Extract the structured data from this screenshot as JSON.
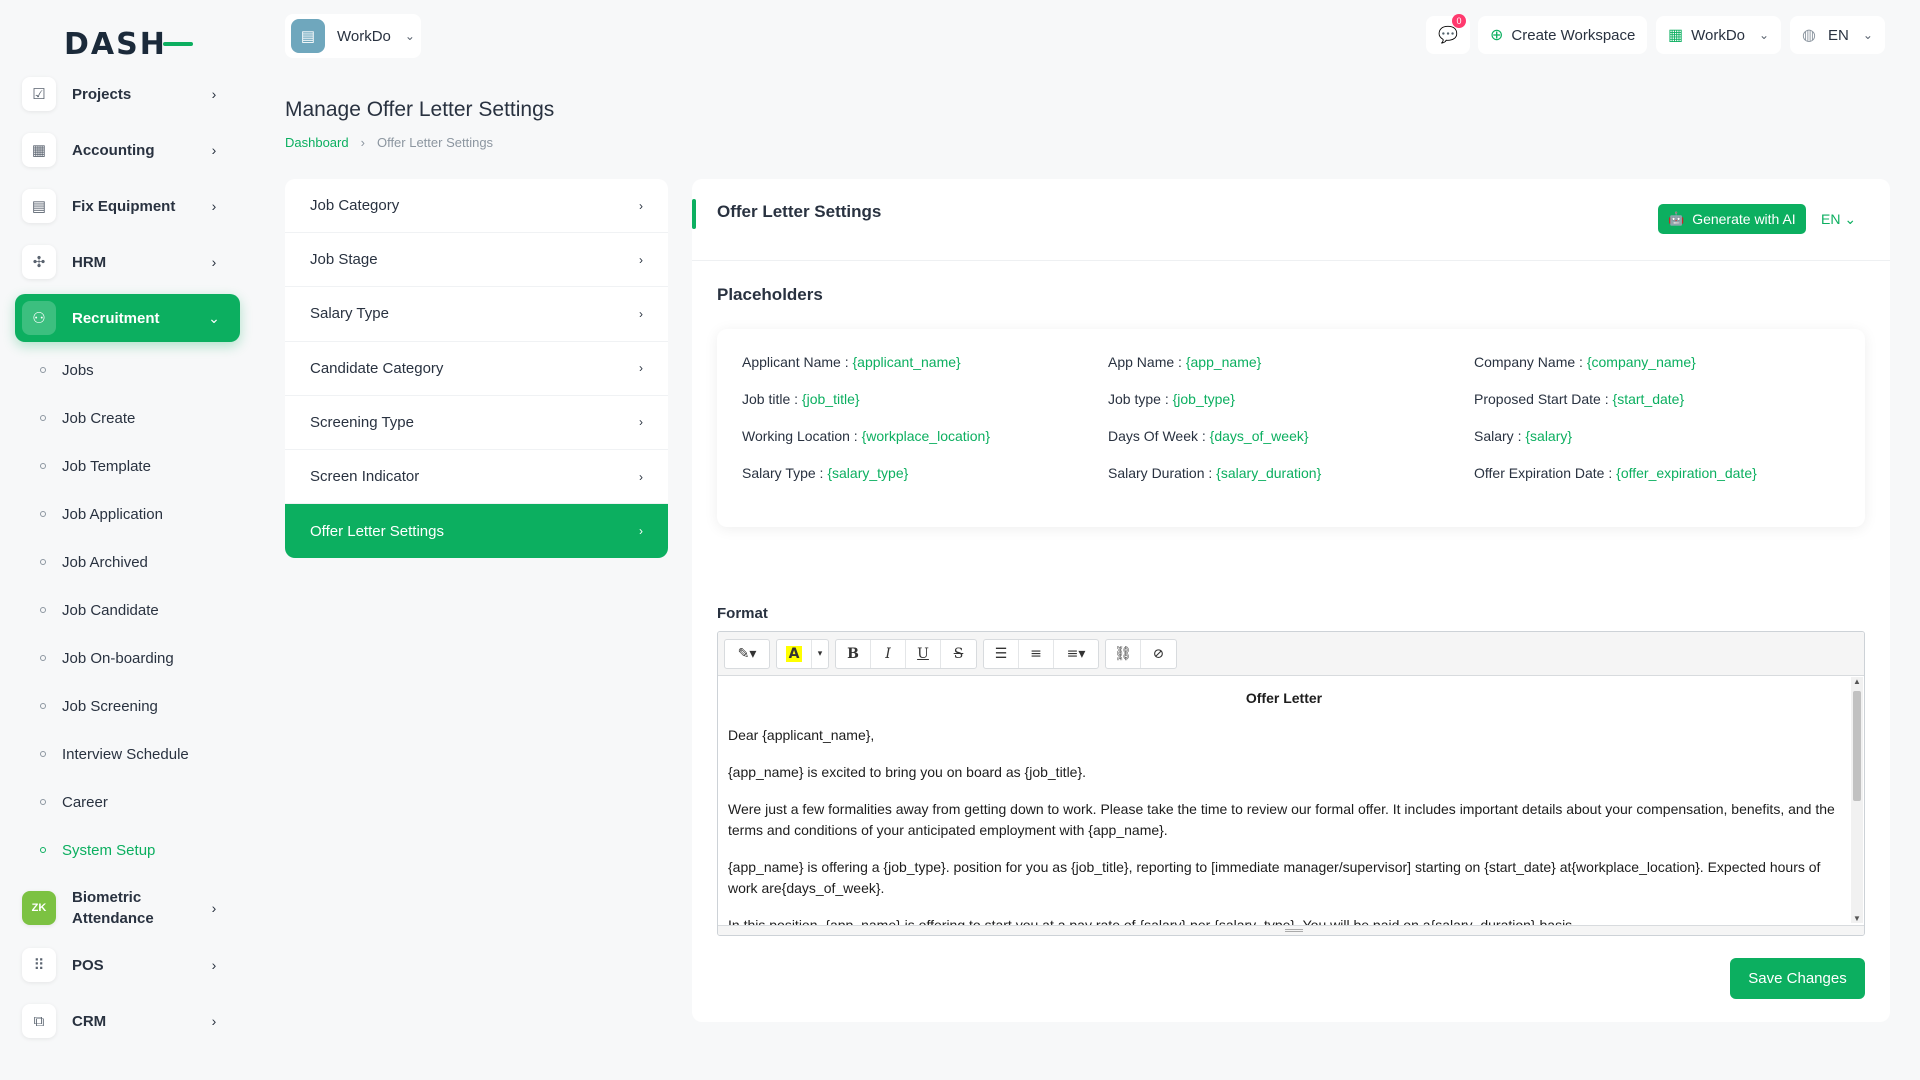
{
  "brand": {
    "logo": "DASH",
    "accent": "#0caf60"
  },
  "sidebar": {
    "items": [
      {
        "label": "Projects",
        "icon": "checkbox-icon"
      },
      {
        "label": "Accounting",
        "icon": "grid-icon"
      },
      {
        "label": "Fix Equipment",
        "icon": "archive-icon"
      },
      {
        "label": "HRM",
        "icon": "network-icon"
      },
      {
        "label": "Recruitment",
        "icon": "user-plus-icon"
      },
      {
        "label": "Biometric Attendance",
        "icon": "zk-icon"
      },
      {
        "label": "POS",
        "icon": "dots-grid-icon"
      },
      {
        "label": "CRM",
        "icon": "layers-icon"
      }
    ],
    "recruitment_sub": [
      "Jobs",
      "Job Create",
      "Job Template",
      "Job Application",
      "Job Archived",
      "Job Candidate",
      "Job On-boarding",
      "Job Screening",
      "Interview Schedule",
      "Career",
      "System Setup"
    ]
  },
  "header": {
    "workspace": "WorkDo",
    "notification_count": "0",
    "create_workspace": "Create Workspace",
    "workspace_menu": "WorkDo",
    "language": "EN"
  },
  "page": {
    "title": "Manage Offer Letter Settings",
    "breadcrumb": {
      "home": "Dashboard",
      "current": "Offer Letter Settings"
    }
  },
  "settings_menu": [
    "Job Category",
    "Job Stage",
    "Salary Type",
    "Candidate Category",
    "Screening Type",
    "Screen Indicator",
    "Offer Letter Settings"
  ],
  "card": {
    "title": "Offer Letter Settings",
    "ai_button": "Generate with AI",
    "lang": "EN",
    "placeholders_title": "Placeholders",
    "placeholders": [
      {
        "label": "Applicant Name : ",
        "value": "{applicant_name}"
      },
      {
        "label": "App Name : ",
        "value": "{app_name}"
      },
      {
        "label": "Company Name : ",
        "value": "{company_name}"
      },
      {
        "label": "Job title : ",
        "value": "{job_title}"
      },
      {
        "label": "Job type : ",
        "value": "{job_type}"
      },
      {
        "label": "Proposed Start Date : ",
        "value": "{start_date}"
      },
      {
        "label": "Working Location : ",
        "value": "{workplace_location}"
      },
      {
        "label": "Days Of Week : ",
        "value": "{days_of_week}"
      },
      {
        "label": "Salary : ",
        "value": "{salary}"
      },
      {
        "label": "Salary Type : ",
        "value": "{salary_type}"
      },
      {
        "label": "Salary Duration : ",
        "value": "{salary_duration}"
      },
      {
        "label": "Offer Expiration Date : ",
        "value": "{offer_expiration_date}"
      }
    ],
    "format_label": "Format",
    "editor": {
      "heading": "Offer Letter",
      "paragraphs": [
        "Dear {applicant_name},",
        "{app_name} is excited to bring you on board as {job_title}.",
        "Were just a few formalities away from getting down to work. Please take the time to review our formal offer. It includes important details about your compensation, benefits, and the terms and conditions of your anticipated employment with {app_name}.",
        "{app_name} is offering a {job_type}. position for you as {job_title}, reporting to [immediate manager/supervisor] starting on {start_date} at{workplace_location}. Expected hours of work are{days_of_week}.",
        "In this position, {app_name} is offering to start you at a pay rate of {salary} per {salary_type}. You will be paid on a{salary_duration} basis."
      ]
    },
    "save_button": "Save Changes"
  }
}
